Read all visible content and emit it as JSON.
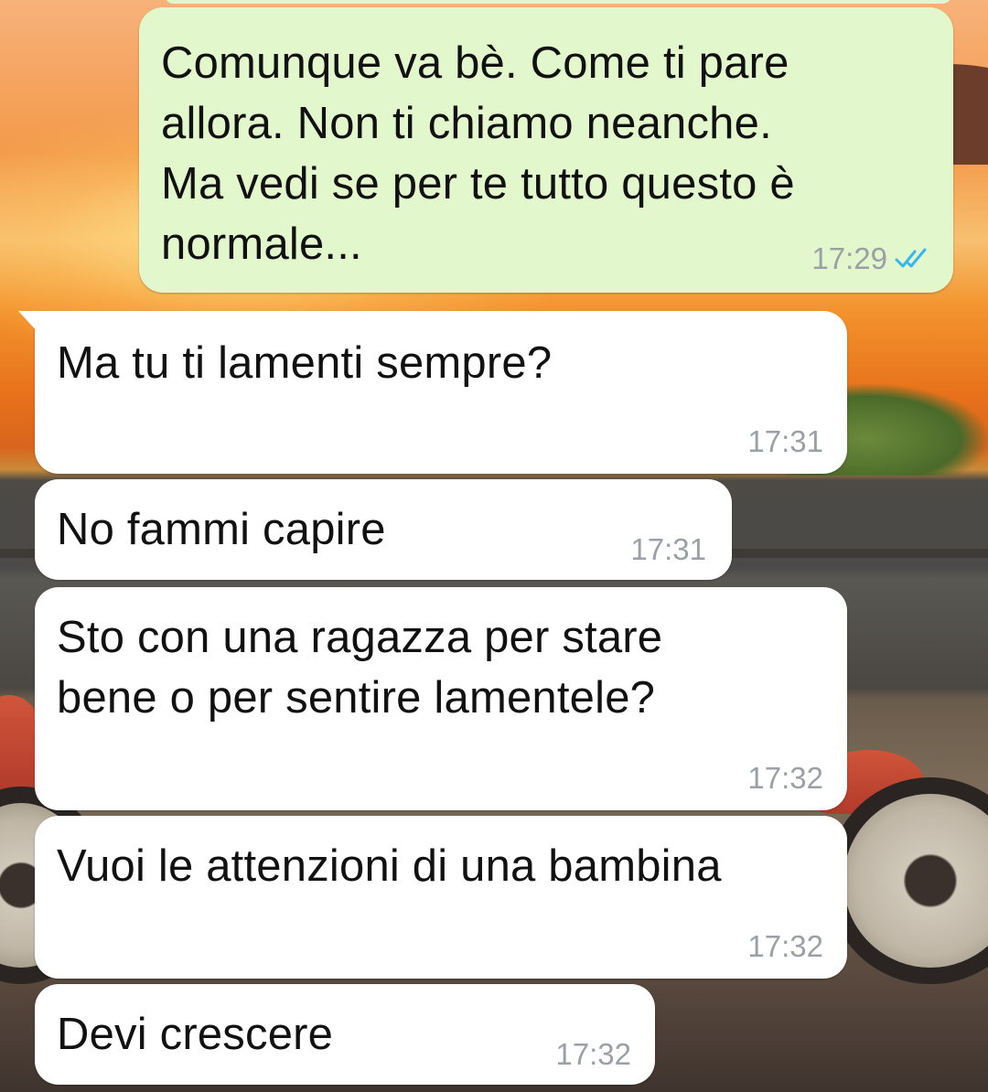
{
  "colors": {
    "outgoing_bubble": "#e2f7cb",
    "incoming_bubble": "#ffffff",
    "timestamp": "#9aa0a6",
    "read_ticks": "#34b7f1"
  },
  "messages": [
    {
      "direction": "outgoing",
      "text": "Comunque va bè. Come ti pare\nallora. Non ti chiamo neanche.\nMa vedi se per te tutto questo è\nnormale...",
      "time": "17:29",
      "status_icon": "double-check-read-icon"
    },
    {
      "direction": "incoming",
      "text": "Ma tu ti lamenti sempre?",
      "time": "17:31"
    },
    {
      "direction": "incoming",
      "text": "No fammi capire",
      "time": "17:31"
    },
    {
      "direction": "incoming",
      "text": "Sto con una ragazza per stare\nbene o per sentire lamentele?",
      "time": "17:32"
    },
    {
      "direction": "incoming",
      "text": "Vuoi le attenzioni di una bambina",
      "time": "17:32"
    },
    {
      "direction": "incoming",
      "text": "Devi crescere",
      "time": "17:32"
    }
  ]
}
